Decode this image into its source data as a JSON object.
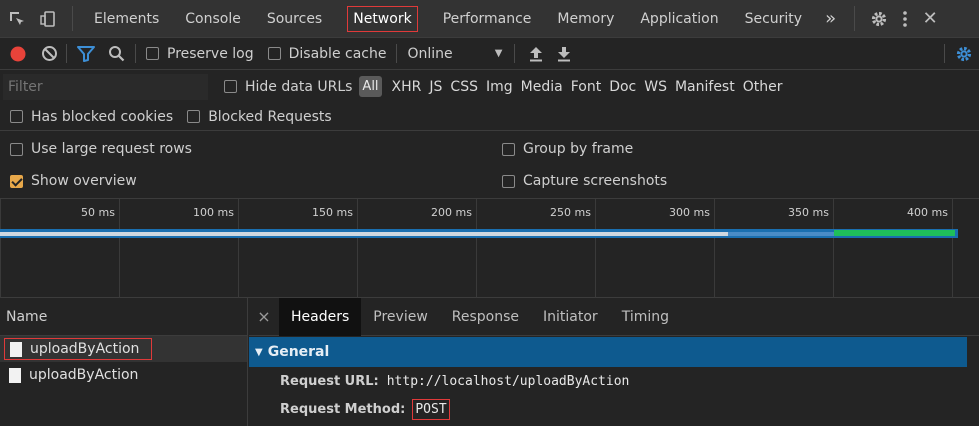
{
  "tabs": [
    "Elements",
    "Console",
    "Sources",
    "Network",
    "Performance",
    "Memory",
    "Application",
    "Security"
  ],
  "active_tab": "Network",
  "tabs_overflow": "»",
  "toolbar": {
    "preserve_log": "Preserve log",
    "disable_cache": "Disable cache",
    "throttle": "Online"
  },
  "filter": {
    "placeholder": "Filter",
    "hide_data_urls": "Hide data URLs",
    "types": [
      "All",
      "XHR",
      "JS",
      "CSS",
      "Img",
      "Media",
      "Font",
      "Doc",
      "WS",
      "Manifest",
      "Other"
    ]
  },
  "blocked": {
    "has_blocked_cookies": "Has blocked cookies",
    "blocked_requests": "Blocked Requests"
  },
  "settings": {
    "large_rows": "Use large request rows",
    "group_by_frame": "Group by frame",
    "show_overview": "Show overview",
    "capture_screenshots": "Capture screenshots"
  },
  "overview": {
    "ticks": [
      "50 ms",
      "100 ms",
      "150 ms",
      "200 ms",
      "250 ms",
      "300 ms",
      "350 ms",
      "400 ms"
    ]
  },
  "requests": {
    "header": "Name",
    "items": [
      "uploadByAction",
      "uploadByAction"
    ]
  },
  "details": {
    "tabs": [
      "Headers",
      "Preview",
      "Response",
      "Initiator",
      "Timing"
    ],
    "active": "Headers",
    "section": "General",
    "request_url_label": "Request URL:",
    "request_url": "http://localhost/uploadByAction",
    "request_method_label": "Request Method:",
    "request_method": "POST"
  },
  "colors": {
    "record": "#e8433a",
    "filter_active": "#3d8fd6",
    "general_header": "#0e5a8f",
    "highlight_outline": "#e03a3a"
  }
}
